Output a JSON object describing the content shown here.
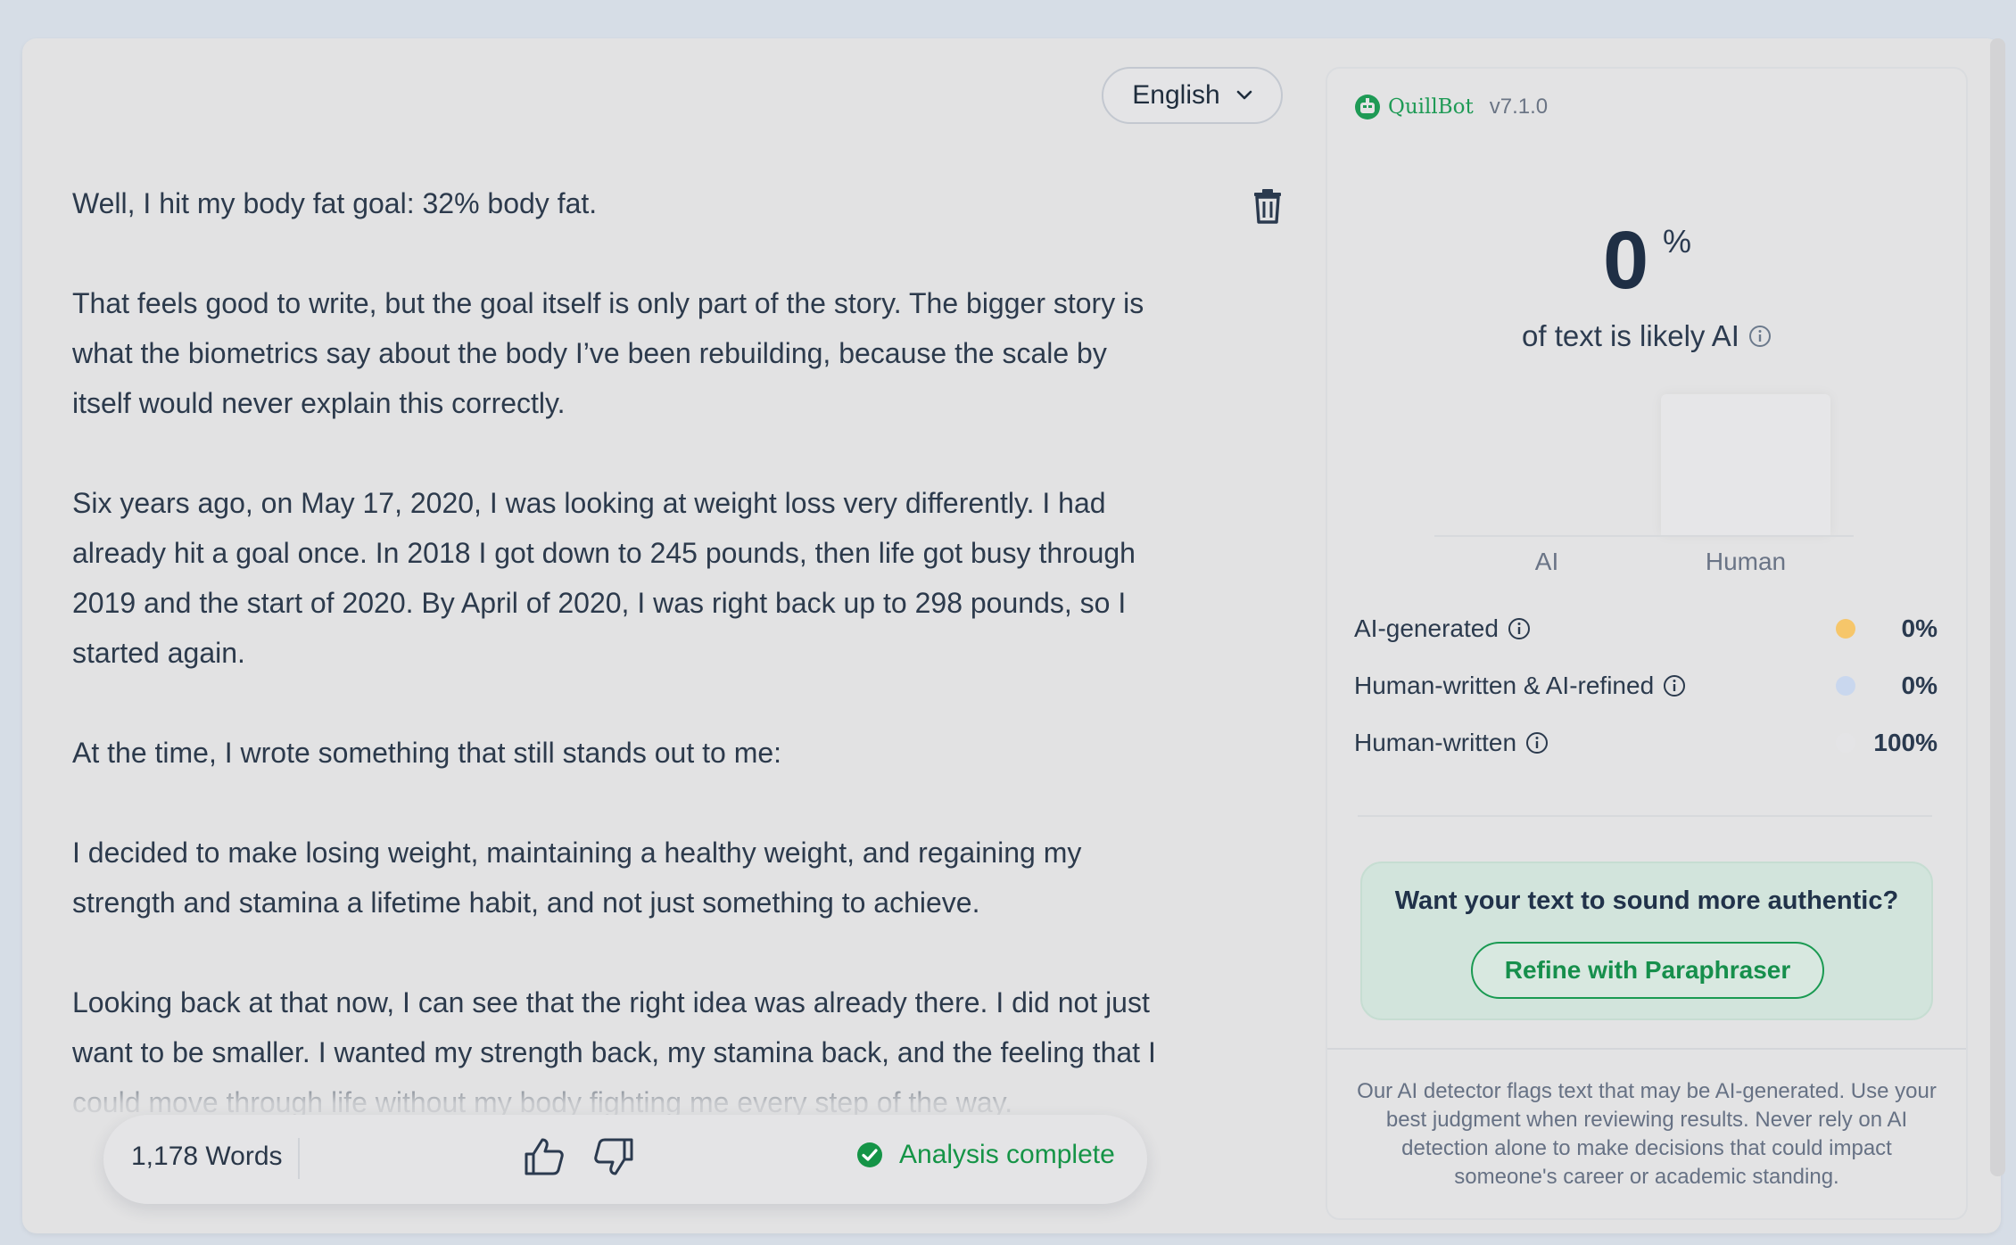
{
  "editor": {
    "language": "English",
    "paragraphs": [
      "Well, I hit my body fat goal: 32% body fat.",
      "That feels good to write, but the goal itself is only part of the story. The bigger story is what the biometrics say about the body I’ve been rebuilding, because the scale by itself would never explain this correctly.",
      "Six years ago, on May 17, 2020, I was looking at weight loss very differently. I had already hit a goal once. In 2018 I got down to 245 pounds, then life got busy through 2019 and the start of 2020. By April of 2020, I was right back up to 298 pounds, so I started again.",
      "At the time, I wrote something that still stands out to me:",
      "I decided to make losing weight, maintaining a healthy weight, and regaining my strength and stamina a lifetime habit, and not just something to achieve.",
      "Looking back at that now, I can see that the right idea was already there. I did not just want to be smaller. I wanted my strength back, my stamina back, and the feeling that I could move through life without my body fighting me every step of the way."
    ],
    "word_count": "1,178 Words",
    "status": "Analysis complete"
  },
  "panel": {
    "brand": "QuillBot",
    "version": "v7.1.0",
    "score": "0",
    "score_unit": "%",
    "score_caption": "of text is likely AI",
    "chart_labels": {
      "ai": "AI",
      "human": "Human"
    },
    "rows": [
      {
        "label": "AI-generated",
        "value": "0%",
        "color": "#f6c66a"
      },
      {
        "label": "Human-written & AI-refined",
        "value": "0%",
        "color": "#c9d7ee"
      },
      {
        "label": "Human-written",
        "value": "100%",
        "color": "#e4e4e6"
      }
    ],
    "cta_title": "Want your text to sound more authentic?",
    "cta_button": "Refine with Paraphraser",
    "disclaimer": "Our AI detector flags text that may be AI-generated. Use your best judgment when reviewing results. Never rely on AI detection alone to make decisions that could impact someone's career or academic standing."
  },
  "chart_data": {
    "type": "bar",
    "categories": [
      "AI",
      "Human"
    ],
    "values": [
      0,
      100
    ],
    "ylim": [
      0,
      100
    ]
  },
  "colors": {
    "accent_green": "#159447",
    "ai_color": "#f6c66a",
    "refined_color": "#c9d7ee"
  }
}
